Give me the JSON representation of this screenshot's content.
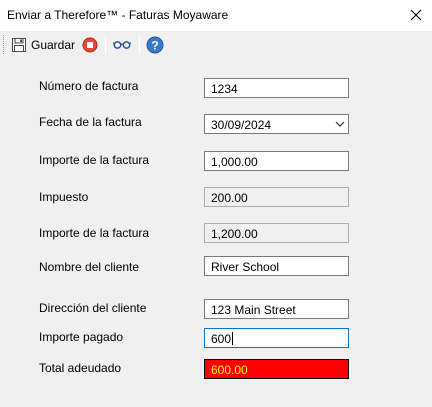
{
  "window": {
    "title": "Enviar a Therefore™ - Faturas Moyaware",
    "close_icon": "close-icon"
  },
  "toolbar": {
    "save_label": "Guardar",
    "icons": [
      "save-icon",
      "stop-icon",
      "glasses-icon",
      "help-icon"
    ],
    "colors": {
      "stop": "#e04a3a",
      "help": "#3a78c9"
    }
  },
  "form": {
    "invoice_number": {
      "label": "Número de factura",
      "value": "1234"
    },
    "invoice_date": {
      "label": "Fecha de la factura",
      "value": "30/09/2024"
    },
    "invoice_amount": {
      "label": "Importe de la factura",
      "value": "1,000.00"
    },
    "tax": {
      "label": "Impuesto",
      "value": "200.00"
    },
    "invoice_amount_total": {
      "label": "Importe de la factura",
      "value": "1,200.00"
    },
    "customer_name": {
      "label": "Nombre del cliente",
      "value": "River School"
    },
    "customer_address": {
      "label": "Dirección del cliente",
      "value": "123 Main Street"
    },
    "amount_paid": {
      "label": "Importe pagado",
      "value": "600"
    },
    "total_due": {
      "label": "Total adeudado",
      "value": "600.00"
    }
  },
  "colors": {
    "alert_background": "#ff0000",
    "alert_text": "#ffff00",
    "focus_border": "#0078d7"
  }
}
